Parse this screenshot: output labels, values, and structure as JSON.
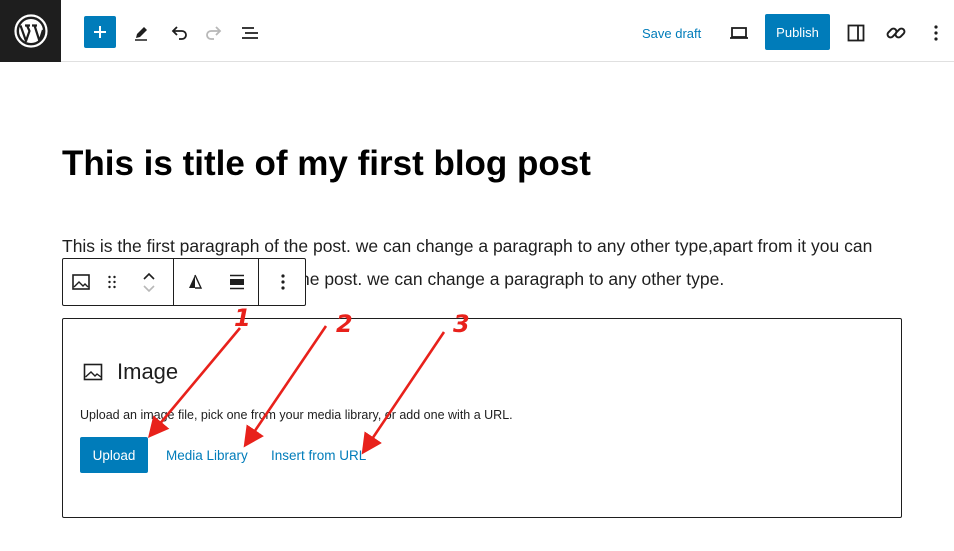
{
  "topbar": {
    "logo_icon": "wordpress-logo-icon",
    "add_icon": "plus-icon",
    "tools_icon": "pencil-icon",
    "undo_icon": "undo-icon",
    "redo_icon": "redo-icon",
    "outline_icon": "list-view-icon",
    "save_draft_label": "Save draft",
    "preview_icon": "desktop-icon",
    "publish_label": "Publish",
    "settings_icon": "sidebar-toggle-icon",
    "link_icon": "link-icon",
    "more_icon": "more-vertical-icon"
  },
  "post": {
    "title": "This is title of my first blog post",
    "paragraph_line1": "This is the first paragraph of the post. we can change a paragraph to any other type,apart from it you can",
    "paragraph_line2": "he post. we can change a paragraph to any other type."
  },
  "block_toolbar": {
    "block_type_icon": "image-icon",
    "drag_icon": "drag-handle-icon",
    "move_up_icon": "chevron-up-icon",
    "move_down_icon": "chevron-down-icon",
    "align_icon": "align-icon",
    "width_icon": "wide-width-icon",
    "options_icon": "more-vertical-icon"
  },
  "image_block": {
    "title": "Image",
    "instructions": "Upload an image file, pick one from your media library, or add one with a URL.",
    "upload_label": "Upload",
    "media_library_label": "Media Library",
    "insert_url_label": "Insert from URL"
  },
  "annotations": {
    "labels": [
      "1",
      "2",
      "3"
    ],
    "color": "#e8211b"
  },
  "colors": {
    "accent": "#007cba",
    "dark": "#1e1e1e"
  }
}
